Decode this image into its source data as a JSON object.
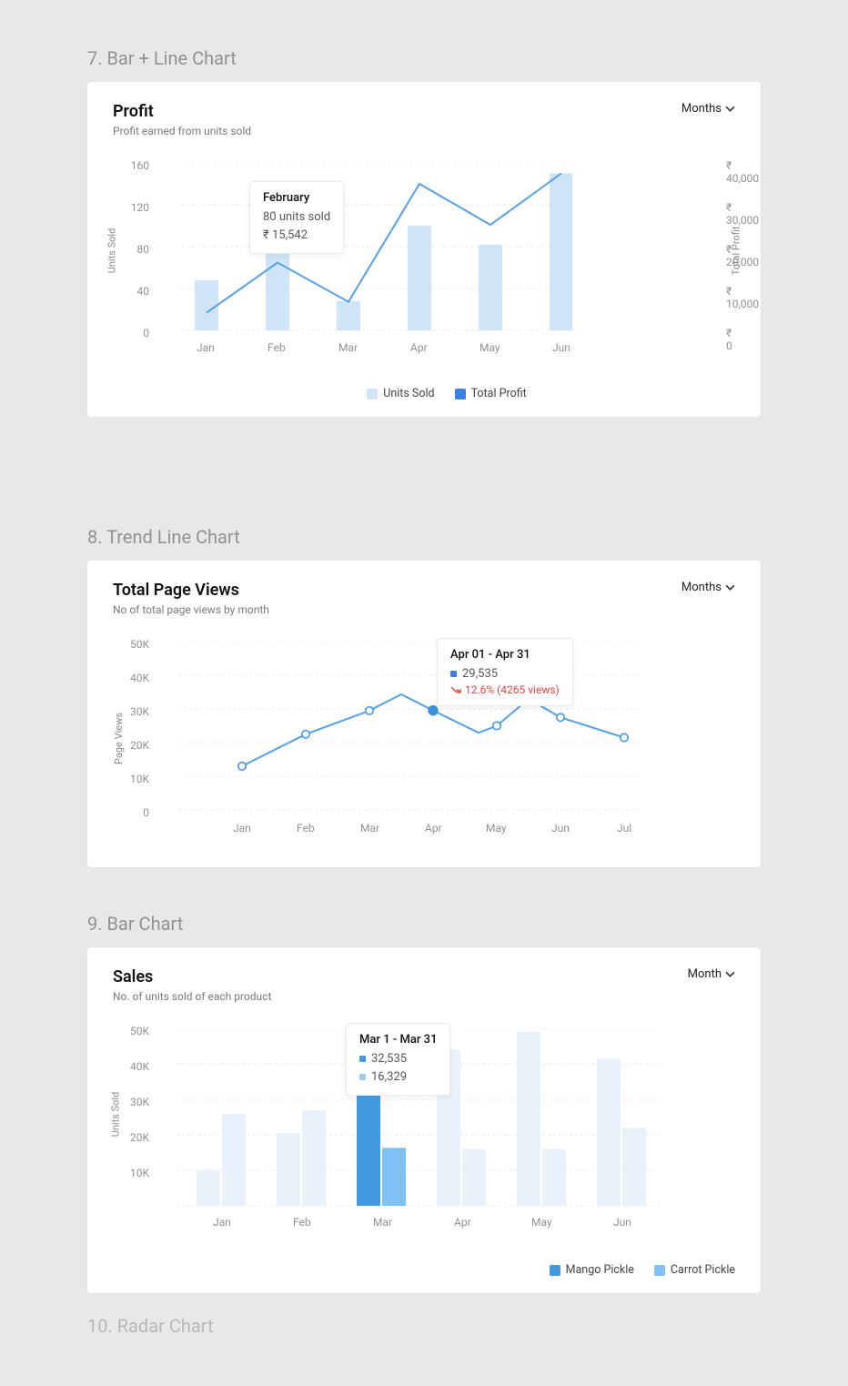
{
  "section7": {
    "title": "7. Bar + Line Chart"
  },
  "section8": {
    "title": "8. Trend Line Chart"
  },
  "section9": {
    "title": "9. Bar Chart"
  },
  "section10": {
    "title": "10. Radar Chart"
  },
  "chart7": {
    "title": "Profit",
    "subtitle": "Profit earned from units sold",
    "dropdown": "Months",
    "y_axis_label": "Units Sold",
    "y2_axis_label": "Total Profit",
    "y_ticks": [
      "0",
      "40",
      "80",
      "120",
      "160"
    ],
    "y2_ticks": [
      "₹ 0",
      "₹ 10,000",
      "₹ 20,000",
      "₹ 30,000",
      "₹ 40,000"
    ],
    "x_ticks": [
      "Jan",
      "Feb",
      "Mar",
      "Apr",
      "May",
      "Jun"
    ],
    "legend": {
      "a": "Units Sold",
      "b": "Total Profit"
    },
    "tooltip": {
      "title": "February",
      "line1": "80 units sold",
      "line2": "₹ 15,542"
    }
  },
  "chart8": {
    "title": "Total Page Views",
    "subtitle": "No of total page views by month",
    "dropdown": "Months",
    "y_axis_label": "Page Views",
    "y_ticks": [
      "0",
      "10K",
      "20K",
      "30K",
      "40K",
      "50K"
    ],
    "x_ticks": [
      "Jan",
      "Feb",
      "Mar",
      "Apr",
      "May",
      "Jun",
      "Jul"
    ],
    "tooltip": {
      "title": "Apr 01 - Apr 31",
      "value": "29,535",
      "delta": "12.6% (4265 views)"
    }
  },
  "chart9": {
    "title": "Sales",
    "subtitle": "No. of units sold of each product",
    "dropdown": "Month",
    "y_axis_label": "Units Sold",
    "y_ticks": [
      "10K",
      "20K",
      "30K",
      "40K",
      "50K"
    ],
    "x_ticks": [
      "Jan",
      "Feb",
      "Mar",
      "Apr",
      "May",
      "Jun"
    ],
    "legend": {
      "a": "Mango Pickle",
      "b": "Carrot Pickle"
    },
    "tooltip": {
      "title": "Mar 1 - Mar 31",
      "v1": "32,535",
      "v2": "16,329"
    }
  },
  "chart_data": [
    {
      "id": "chart7",
      "type": "bar+line",
      "title": "Profit",
      "subtitle": "Profit earned from units sold",
      "categories": [
        "Jan",
        "Feb",
        "Mar",
        "Apr",
        "May",
        "Jun"
      ],
      "series": [
        {
          "name": "Units Sold",
          "kind": "bar",
          "values": [
            48,
            80,
            28,
            100,
            82,
            150
          ],
          "axis": "left"
        },
        {
          "name": "Total Profit",
          "kind": "line",
          "values": [
            4200,
            16200,
            6800,
            35000,
            25200,
            37500
          ],
          "axis": "right",
          "unit": "₹"
        }
      ],
      "y_left": {
        "label": "Units Sold",
        "range": [
          0,
          160
        ],
        "ticks": [
          0,
          40,
          80,
          120,
          160
        ]
      },
      "y_right": {
        "label": "Total Profit",
        "range": [
          0,
          40000
        ],
        "ticks": [
          0,
          10000,
          20000,
          30000,
          40000
        ],
        "prefix": "₹ "
      },
      "tooltip": {
        "month": "February",
        "units": 80,
        "profit": 15542
      }
    },
    {
      "id": "chart8",
      "type": "line",
      "title": "Total Page Views",
      "subtitle": "No of total page views by month",
      "categories": [
        "Jan",
        "Feb",
        "Mar",
        "Apr",
        "May",
        "Jun",
        "Jul"
      ],
      "series": [
        {
          "name": "Page Views",
          "values": [
            13000,
            22500,
            29500,
            29535,
            25000,
            27500,
            21500
          ]
        }
      ],
      "y": {
        "label": "Page Views",
        "range": [
          0,
          50000
        ],
        "ticks": [
          0,
          10000,
          20000,
          30000,
          40000,
          50000
        ]
      },
      "tooltip": {
        "range": "Apr 01 - Apr 31",
        "value": 29535,
        "delta_pct": -12.6,
        "delta_abs": 4265
      }
    },
    {
      "id": "chart9",
      "type": "bar",
      "title": "Sales",
      "subtitle": "No. of units sold of each product",
      "categories": [
        "Jan",
        "Feb",
        "Mar",
        "Apr",
        "May",
        "Jun"
      ],
      "series": [
        {
          "name": "Mango Pickle",
          "values": [
            10000,
            20500,
            32535,
            44000,
            49000,
            41500
          ]
        },
        {
          "name": "Carrot Pickle",
          "values": [
            26000,
            27000,
            16329,
            16000,
            16000,
            22000
          ]
        }
      ],
      "y": {
        "label": "Units Sold",
        "range": [
          0,
          50000
        ],
        "ticks": [
          10000,
          20000,
          30000,
          40000,
          50000
        ]
      },
      "highlighted_category": "Mar",
      "tooltip": {
        "range": "Mar 1 - Mar 31",
        "mango": 32535,
        "carrot": 16329
      }
    }
  ]
}
